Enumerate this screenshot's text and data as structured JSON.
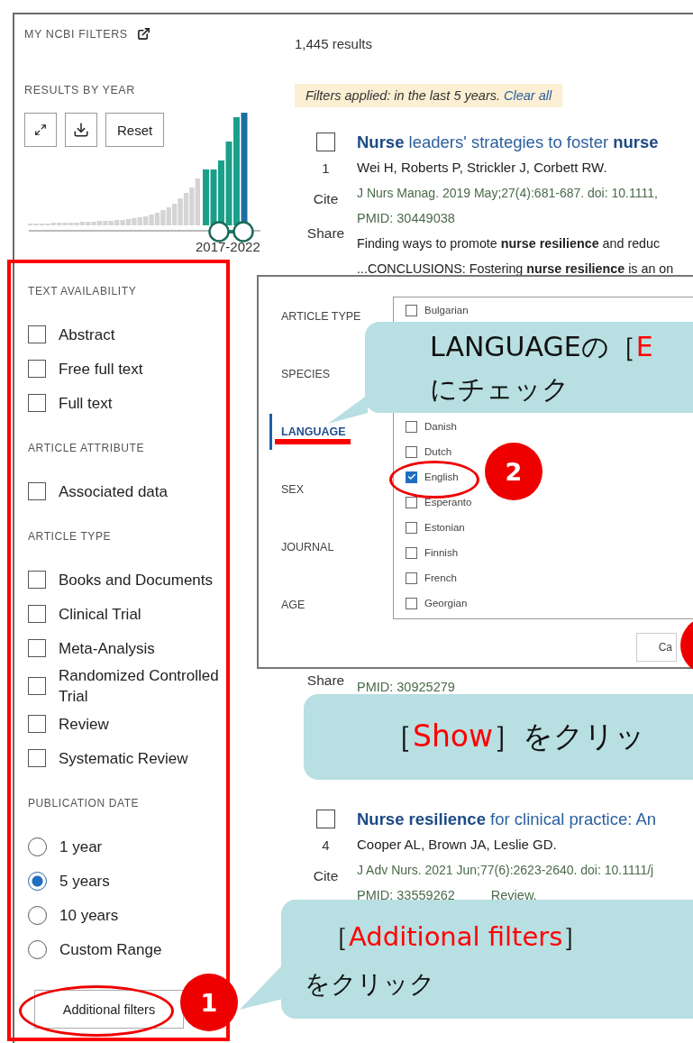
{
  "sidebar": {
    "title": "MY NCBI FILTERS",
    "results_by_year": {
      "heading": "RESULTS BY YEAR",
      "reset_button": "Reset",
      "range_label": "2017-2022"
    },
    "filters": [
      {
        "heading": "TEXT AVAILABILITY",
        "kind": "checkbox",
        "options": [
          {
            "label": "Abstract",
            "checked": false
          },
          {
            "label": "Free full text",
            "checked": false
          },
          {
            "label": "Full text",
            "checked": false
          }
        ]
      },
      {
        "heading": "ARTICLE ATTRIBUTE",
        "kind": "checkbox",
        "options": [
          {
            "label": "Associated data",
            "checked": false
          }
        ]
      },
      {
        "heading": "ARTICLE TYPE",
        "kind": "checkbox",
        "options": [
          {
            "label": "Books and Documents",
            "checked": false
          },
          {
            "label": "Clinical Trial",
            "checked": false
          },
          {
            "label": "Meta-Analysis",
            "checked": false
          },
          {
            "label": "Randomized Controlled Trial",
            "checked": false
          },
          {
            "label": "Review",
            "checked": false
          },
          {
            "label": "Systematic Review",
            "checked": false
          }
        ]
      },
      {
        "heading": "PUBLICATION DATE",
        "kind": "radio",
        "options": [
          {
            "label": "1 year",
            "selected": false
          },
          {
            "label": "5 years",
            "selected": true
          },
          {
            "label": "10 years",
            "selected": false
          },
          {
            "label": "Custom Range",
            "selected": false
          }
        ]
      }
    ],
    "additional_filters_button": "Additional filters"
  },
  "results": {
    "count": "1,445 results",
    "filter_notice": {
      "text": "Filters applied: in the last 5 years.",
      "link": "Clear all"
    },
    "items": [
      {
        "checked": false,
        "number": "1",
        "actions": [
          "Cite",
          "Share"
        ],
        "title": "**Nurse** leaders' strategies to foster **nurse**",
        "authors": "Wei H, Roberts P, Strickler J, Corbett RW.",
        "journal": "J Nurs Manag. 2019 May;27(4):681-687. doi: 10.1111,",
        "pmid": "PMID: 30449038",
        "snippets": [
          "Finding ways to promote **nurse resilience** and reduc",
          "...CONCLUSIONS: Fostering **nurse resilience** is an on"
        ]
      },
      {
        "actions": [
          "Share"
        ],
        "pmid": "PMID: 30925279"
      },
      {
        "checked": false,
        "number": "4",
        "actions": [
          "Cite"
        ],
        "title": "**Nurse resilience** for clinical practice: An",
        "authors": "Cooper AL, Brown JA, Leslie GD.",
        "journal": "J Adv Nurs. 2021 Jun;77(6):2623-2640. doi: 10.1111/j",
        "pmid": "PMID: 33559262",
        "tag": "Review."
      }
    ]
  },
  "dialog": {
    "nav": [
      {
        "label": "ARTICLE TYPE",
        "selected": false
      },
      {
        "label": "SPECIES",
        "selected": false
      },
      {
        "label": "LANGUAGE",
        "selected": true
      },
      {
        "label": "SEX",
        "selected": false
      },
      {
        "label": "JOURNAL",
        "selected": false
      },
      {
        "label": "AGE",
        "selected": false
      }
    ],
    "languages": [
      {
        "label": "Bulgarian",
        "checked": false
      },
      {
        "label": "Danish",
        "checked": false
      },
      {
        "label": "Dutch",
        "checked": false
      },
      {
        "label": "English",
        "checked": true
      },
      {
        "label": "Esperanto",
        "checked": false
      },
      {
        "label": "Estonian",
        "checked": false
      },
      {
        "label": "Finnish",
        "checked": false
      },
      {
        "label": "French",
        "checked": false
      },
      {
        "label": "Georgian",
        "checked": false
      }
    ],
    "cancel_button": "Ca"
  },
  "annotations": {
    "callouts": [
      {
        "lines": [
          [
            {
              "text": "LANGUAGEの［",
              "emphasis": false
            },
            {
              "text": "E",
              "emphasis": true
            }
          ],
          [
            {
              "text": "にチェック",
              "emphasis": false
            }
          ]
        ]
      },
      {
        "lines": [
          [
            {
              "text": "［",
              "emphasis": false
            },
            {
              "text": "Show",
              "emphasis": true
            },
            {
              "text": "］をクリッ",
              "emphasis": false
            }
          ]
        ]
      },
      {
        "lines": [
          [
            {
              "text": "［",
              "emphasis": false
            },
            {
              "text": "Additional filters",
              "emphasis": true
            },
            {
              "text": "］",
              "emphasis": false
            }
          ],
          [
            {
              "text": "をクリック",
              "emphasis": false
            }
          ]
        ]
      }
    ],
    "badges": [
      "1",
      "2"
    ]
  }
}
